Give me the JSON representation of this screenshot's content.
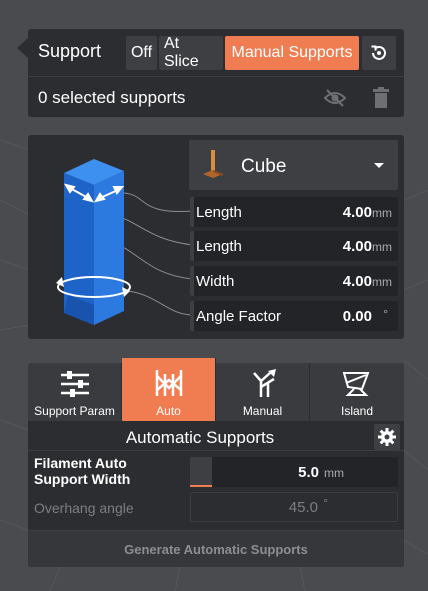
{
  "support": {
    "title": "Support",
    "modes": [
      {
        "label": "Off",
        "active": false
      },
      {
        "label": "At Slice",
        "active": false
      },
      {
        "label": "Manual Supports",
        "active": true
      }
    ],
    "selected_text": "0 selected supports",
    "icons": {
      "reset": "reset-icon",
      "visibility": "eye-off-icon",
      "delete": "trash-icon"
    }
  },
  "shape": {
    "selected": "Cube",
    "params": [
      {
        "label": "Length",
        "value": "4.00",
        "unit": "mm"
      },
      {
        "label": "Length",
        "value": "4.00",
        "unit": "mm"
      },
      {
        "label": "Width",
        "value": "4.00",
        "unit": "mm"
      },
      {
        "label": "Angle Factor",
        "value": "0.00",
        "unit": "°"
      }
    ]
  },
  "tabs": [
    {
      "label": "Support Param",
      "icon": "sliders-icon",
      "active": false
    },
    {
      "label": "Auto",
      "icon": "auto-supports-icon",
      "active": true
    },
    {
      "label": "Manual",
      "icon": "manual-supports-icon",
      "active": false
    },
    {
      "label": "Island",
      "icon": "island-icon",
      "active": false
    }
  ],
  "auto": {
    "title": "Automatic Supports",
    "filament_label_line1": "Filament Auto",
    "filament_label_line2": "Support Width",
    "filament_value": "5.0",
    "filament_unit": "mm",
    "overhang_label": "Overhang angle",
    "overhang_value": "45.0",
    "overhang_unit": "°",
    "generate_label": "Generate Automatic Supports"
  },
  "colors": {
    "accent": "#f07d52",
    "panel": "#2c2d30",
    "button": "#3e3f43",
    "cube": "#1f6fd1"
  }
}
